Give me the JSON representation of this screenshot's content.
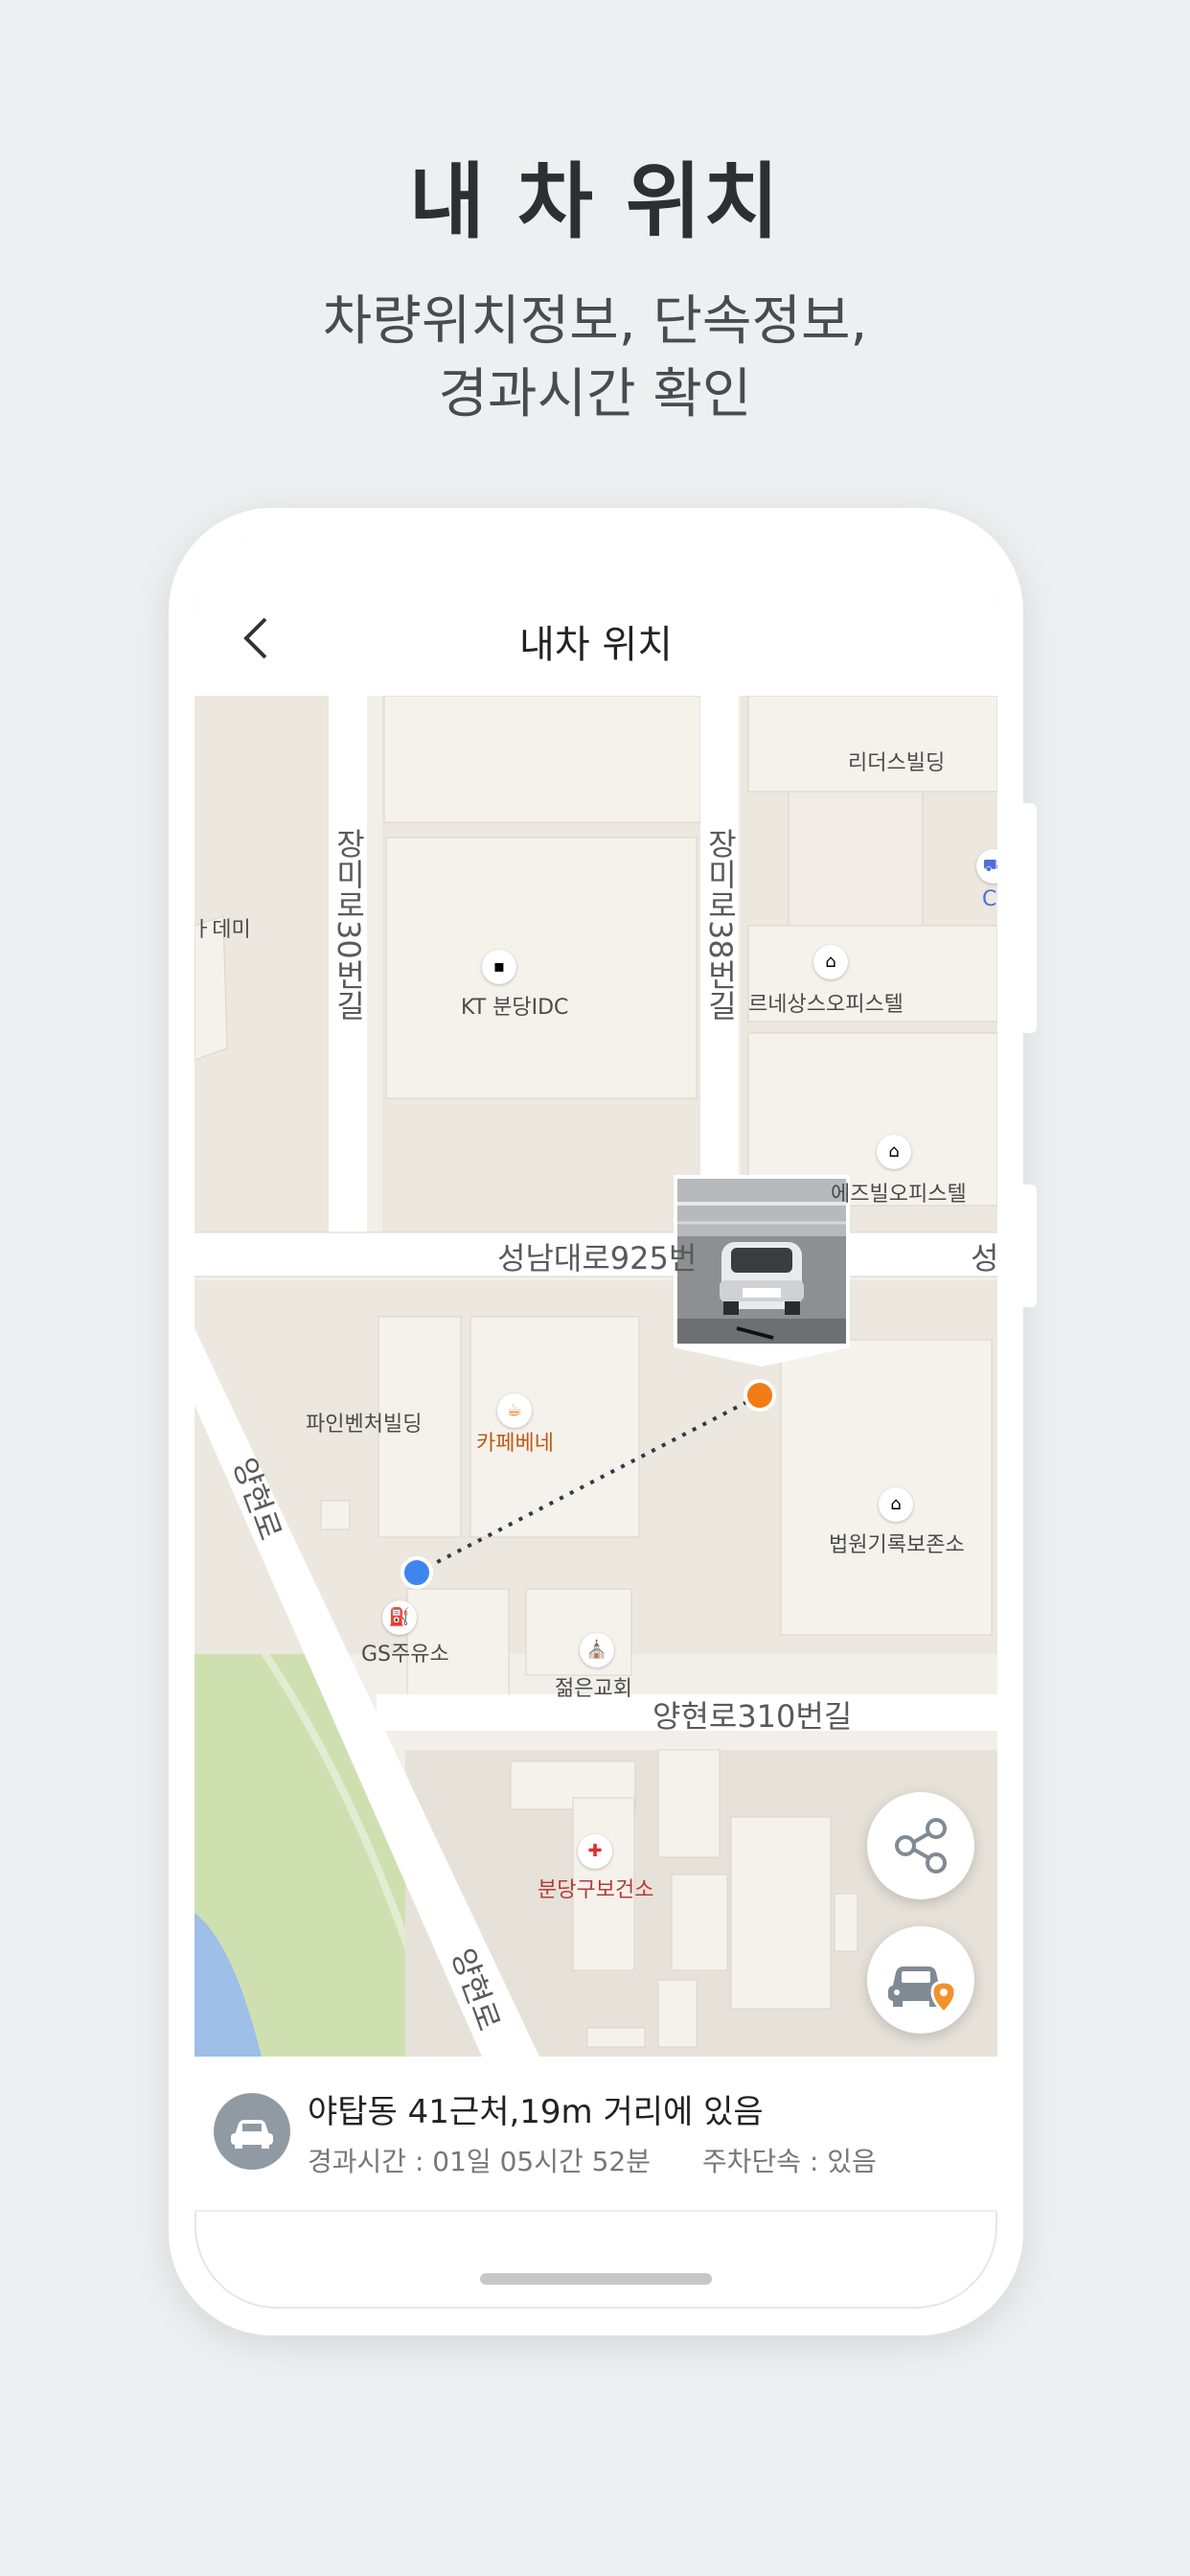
{
  "promo": {
    "title": "내 차 위치",
    "subtitle_line1": "차량위치정보, 단속정보,",
    "subtitle_line2": "경과시간 확인"
  },
  "appbar": {
    "title": "내차 위치",
    "back_icon": "chevron-left-icon"
  },
  "map": {
    "labels": {
      "leaders": "리더스빌딩",
      "academy": "ㅏ데미",
      "kt": "KT 분당IDC",
      "renaissance": "르네상스오피스텔",
      "c_mark": "C",
      "ezville": "에즈빌오피스텔",
      "pinventure": "파인벤처빌딩",
      "caffe": "카페베네",
      "court": "법원기록보존소",
      "gs": "GS주유소",
      "church": "젊은교회",
      "health": "분당구보건소"
    },
    "roads": {
      "jangmi30": "장미로30번길",
      "jangmi38": "장미로38번길",
      "seongnam": "성남대로925번",
      "seongnam_end": "성",
      "yanghyeon310": "양현로310번길",
      "yanghyeon_a": "양현로",
      "yanghyeon_b": "양현로"
    },
    "colors": {
      "current_dot": "#3f85ee",
      "car_dot": "#f37b16",
      "path": "#2f3a4a"
    }
  },
  "fabs": {
    "share_icon": "share-icon",
    "car_location_icon": "car-location-icon"
  },
  "info": {
    "avatar_icon": "car-icon",
    "address": "야탑동 41근처,19m 거리에 있음",
    "elapsed": "경과시간 : 01일 05시간 52분",
    "parking": "주차단속 : 있음"
  }
}
